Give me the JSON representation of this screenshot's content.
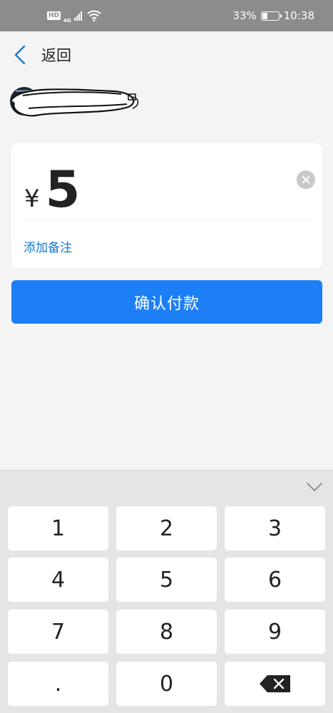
{
  "status_bar": {
    "hd": "HD",
    "network": "4G",
    "battery_percent_text": "33%",
    "battery_level": 0.33,
    "time": "10:38"
  },
  "nav": {
    "back_icon": "chevron-left-icon",
    "title": "返回"
  },
  "payment": {
    "currency_symbol": "¥",
    "amount": "5",
    "clear_icon": "clear-circle-icon",
    "add_remark_label": "添加备注"
  },
  "confirm_button_label": "确认付款",
  "keyboard": {
    "collapse_icon": "chevron-down-icon",
    "keys": [
      "1",
      "2",
      "3",
      "4",
      "5",
      "6",
      "7",
      "8",
      "9",
      ".",
      "0"
    ],
    "delete_icon": "backspace-icon"
  },
  "colors": {
    "accent_blue": "#1d7ff5",
    "link_blue": "#1677d2",
    "status_bar": "#8c8c8c"
  }
}
